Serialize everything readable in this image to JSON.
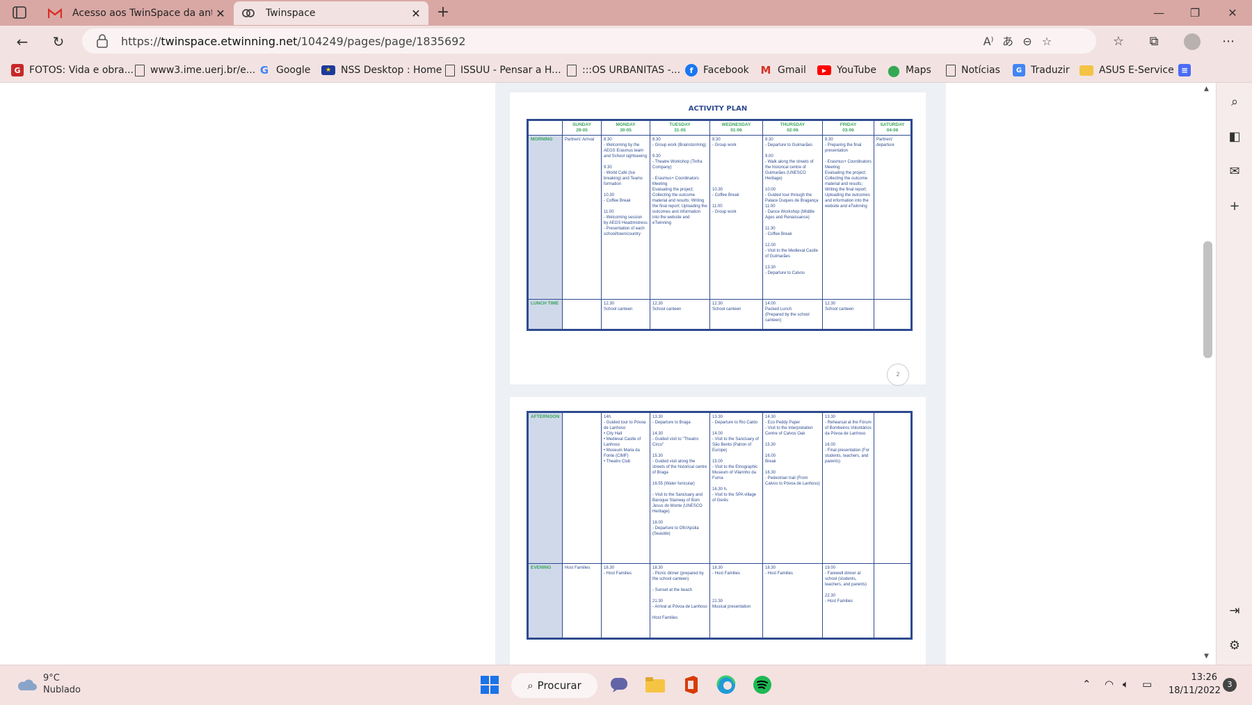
{
  "browser": {
    "tabs": [
      {
        "label": "Acesso aos TwinSpace da antiga"
      },
      {
        "label": "Twinspace"
      }
    ],
    "url_scheme": "https://",
    "url_host": "twinspace.etwinning.net",
    "url_path": "/104249/pages/page/1835692"
  },
  "bookmarks": [
    {
      "label": "FOTOS: Vida e obra...",
      "icon": "gallery-icon"
    },
    {
      "label": "www3.ime.uerj.br/e...",
      "icon": "page-icon"
    },
    {
      "label": "Google",
      "icon": "google-icon"
    },
    {
      "label": "NSS Desktop : Home",
      "icon": "eu-flag-icon"
    },
    {
      "label": "ISSUU - Pensar a H...",
      "icon": "page-icon"
    },
    {
      "label": ":::OS URBANITAS -...",
      "icon": "page-icon"
    },
    {
      "label": "Facebook",
      "icon": "facebook-icon"
    },
    {
      "label": "Gmail",
      "icon": "gmail-icon"
    },
    {
      "label": "YouTube",
      "icon": "youtube-icon"
    },
    {
      "label": "Maps",
      "icon": "maps-icon"
    },
    {
      "label": "Notícias",
      "icon": "page-icon"
    },
    {
      "label": "Traduzir",
      "icon": "translate-icon"
    },
    {
      "label": "ASUS E-Service",
      "icon": "folder-icon"
    }
  ],
  "document": {
    "title": "ACTIVITY PLAN",
    "page_number": "2",
    "days": [
      {
        "day": "SUNDAY",
        "date": "29-05"
      },
      {
        "day": "MONDAY",
        "date": "30-05"
      },
      {
        "day": "TUESDAY",
        "date": "31-05"
      },
      {
        "day": "WEDNESDAY",
        "date": "01-06"
      },
      {
        "day": "THURSDAY",
        "date": "02-06"
      },
      {
        "day": "FRIDAY",
        "date": "03-06"
      },
      {
        "day": "SATURDAY",
        "date": "04-06"
      }
    ],
    "rows_page1": [
      {
        "label": "MORNING",
        "cells": [
          "Partners' Arrival",
          "8.30\n- Welcoming by the AEGS Erasmus team and School sightseeing\n\n9.30\n- World Café (Ice breaking) and Teams formation\n\n10.30\n- Coffee Break\n\n11.00\n- Welcoming session by AEGS Headmistress\n- Presentation of each school/town/country",
          "8.30\n- Group work (Brainstorming)\n\n9.30\n- Theatre Workshop (Tinfra Company)\n\n- Erasmus+ Coordinators Meeting\nEvaluating the project; Collecting the outcome material and results; Writing the final report; Uploading the outcomes and information into the website and eTwinning",
          "8.30\n- Group work\n\n\n\n\n\n\n\n10.30\n- Coffee Break\n\n11.00\n- Group work",
          "8.30\n- Departure to Guimarães\n\n9.00\n- Walk along the streets of the historical centre of Guimarães (UNESCO Heritage)\n\n10.00\n- Guided tour through the Palace Duques de Bragança\n11.00\n- Dance Workshop (Middle Ages and Renaissance)\n\n11.30\n- Coffee Break\n\n12.00\n- Visit to the Medieval Castle of Guimarães\n\n13.30\n- Departure to Calvos",
          "8.30\n- Preparing the final presentation\n\n- Erasmus+ Coordinators Meeting\nEvaluating the project; Collecting the outcome material and results; Writing the final report; Uploading the outcomes and information into the website and eTwinning",
          "Partners' departure"
        ]
      },
      {
        "label": "LUNCH TIME",
        "cells": [
          "",
          "12.30\nSchool canteen",
          "12.30\nSchool canteen",
          "12.30\nSchool canteen",
          "14.00\nPacked Lunch\n(Prepared by the school canteen)",
          "12.30\nSchool canteen",
          ""
        ]
      }
    ],
    "rows_page2": [
      {
        "label": "AFTERNOON",
        "cells": [
          "",
          "14h.\n- Guided tour to Póvoa de Lanhoso\n• City Hall\n• Medieval Castle of Lanhoso\n• Museum Maria da Fonte (CIMF)\n• Theatro Club",
          "13.30\n- Departure to Braga\n\n14.30\n- Guided visit to \"Theatro Circo\"\n\n15.30\n- Guided visit along the streets of the historical centre of Braga\n\n16.55 (Water funicular)\n\n- Visit to the Sanctuary and Baroque Stairway of Bom Jesus do Monte (UNESCO Heritage)\n\n18.00\n- Departure to Ofir/Apúlia (Seaside)",
          "13.30\n- Departure to Rio Caldo\n\n14.00\n- Visit to the Sanctuary of São Bento (Patron of Europe)\n\n15.00\n- Visit to the Etnographic Museum of Vilarinho da Furna\n\n16.30 h.\n- Visit to the SPA village of Gerês",
          "14.30\n- Eco Peddy Paper\n- Visit to the Interpretation Centre of Calvos Oak\n\n15.30\n\n16.00\nBreak\n\n16.30\n- Pedestrian trail (From Calvos to Póvoa de Lanhoso)",
          "13.30\n- Rehearsal at the Fórum of Bombeiros Voluntários da Póvoa de Lanhoso\n\n16.00\n- Final presentation (For students, teachers, and parents)",
          ""
        ]
      },
      {
        "label": "EVENING",
        "cells": [
          "Host Families",
          "18.30\n- Host Families",
          "18.30\n- Picnic dinner (prepared by the school canteen)\n\n- Sunset at the beach\n\n21.30\n- Arrival at Póvoa de Lanhoso\n\nHost Families",
          "18.30\n- Host Families\n\n\n\n\n21.30\nMusical presentation",
          "18.30\n- Host Families",
          "19.00\n- Farewell dinner at school (students, teachers, and parents)\n\n22.30\n- Host Families",
          ""
        ]
      }
    ]
  },
  "taskbar": {
    "temperature": "9°C",
    "condition": "Nublado",
    "search_label": "Procurar",
    "time": "13:26",
    "date": "18/11/2022",
    "notification_count": "3"
  }
}
